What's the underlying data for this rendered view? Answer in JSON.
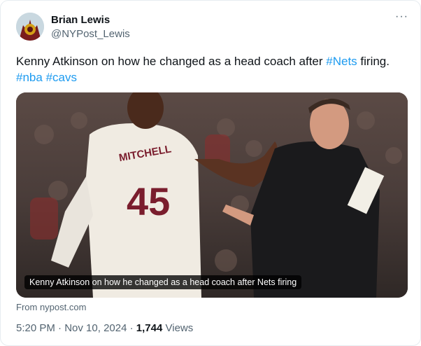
{
  "author": {
    "name": "Brian Lewis",
    "handle": "@NYPost_Lewis"
  },
  "more_icon": "···",
  "tweet": {
    "text_part1": "Kenny Atkinson on how he changed as a head coach after ",
    "hashtag_nets": "#Nets",
    "text_part2": " firing.",
    "hashtag_nba": "#nba",
    "hashtag_cavs": "#cavs"
  },
  "media": {
    "jersey_name": "MITCHELL",
    "jersey_number": "45",
    "caption": "Kenny Atkinson on how he changed as a head coach after Nets firing",
    "source": "From nypost.com"
  },
  "meta": {
    "time": "5:20 PM",
    "sep1": " · ",
    "date": "Nov 10, 2024",
    "sep2": " · ",
    "views_count": "1,744",
    "views_label": " Views"
  },
  "colors": {
    "accent": "#1d9bf0",
    "text": "#0f1419",
    "secondary": "#536471"
  }
}
